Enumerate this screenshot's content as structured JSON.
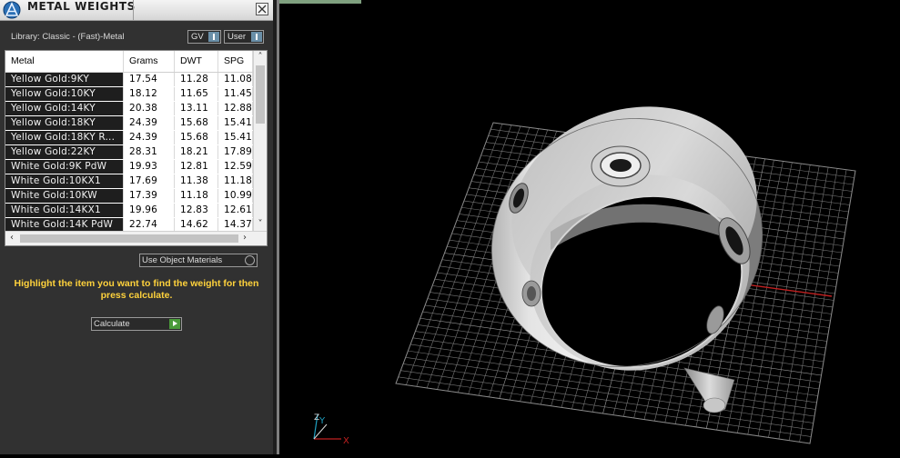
{
  "panel": {
    "title": "METAL WEIGHTS",
    "library_label": "Library: Classic - (Fast)-Metal",
    "gv_button": "GV",
    "user_button": "User",
    "use_object_materials": "Use Object Materials",
    "hint": "Highlight the item you want to find the weight for then press calculate.",
    "calculate_label": "Calculate"
  },
  "table": {
    "columns": [
      "Metal",
      "Grams",
      "DWT",
      "SPG"
    ],
    "rows": [
      [
        "Yellow Gold:9KY",
        "17.54",
        "11.28",
        "11.08"
      ],
      [
        "Yellow Gold:10KY",
        "18.12",
        "11.65",
        "11.45"
      ],
      [
        "Yellow Gold:14KY",
        "20.38",
        "13.11",
        "12.88"
      ],
      [
        "Yellow Gold:18KY",
        "24.39",
        "15.68",
        "15.41"
      ],
      [
        "Yellow Gold:18KY R...",
        "24.39",
        "15.68",
        "15.41"
      ],
      [
        "Yellow Gold:22KY",
        "28.31",
        "18.21",
        "17.89"
      ],
      [
        "White Gold:9K PdW",
        "19.93",
        "12.81",
        "12.59"
      ],
      [
        "White Gold:10KX1",
        "17.69",
        "11.38",
        "11.18"
      ],
      [
        "White Gold:10KW",
        "17.39",
        "11.18",
        "10.99"
      ],
      [
        "White Gold:14KX1",
        "19.96",
        "12.83",
        "12.61"
      ],
      [
        "White Gold:14K PdW",
        "22.74",
        "14.62",
        "14.37"
      ]
    ]
  },
  "viewport": {
    "axis_labels": {
      "x": "X",
      "y": "Y",
      "z": "Z"
    }
  },
  "colors": {
    "hint": "#ffd23c",
    "axis_x": "#c02020",
    "axis_y": "#1fa0c0",
    "grid": "#7a7a7a",
    "calculate_arrow": "#4a9a3a"
  }
}
